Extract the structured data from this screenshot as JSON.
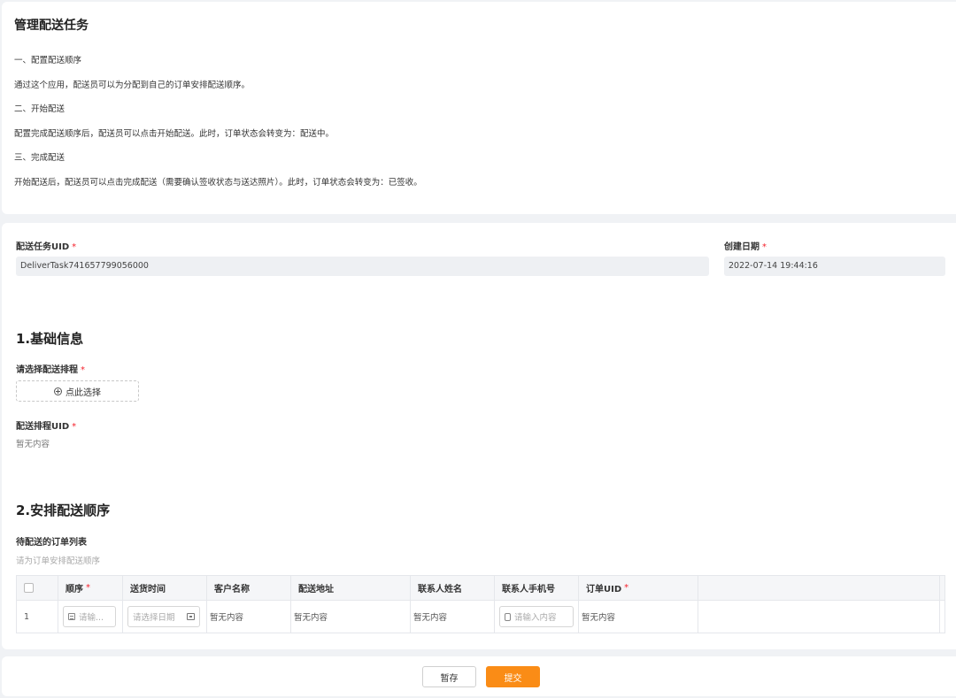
{
  "intro": {
    "title": "管理配送任务",
    "lines": [
      "一、配置配送顺序",
      "通过这个应用，配送员可以为分配到自己的订单安排配送顺序。",
      "二、开始配送",
      "配置完成配送顺序后，配送员可以点击开始配送。此时，订单状态会转变为：配送中。",
      "三、完成配送",
      "开始配送后，配送员可以点击完成配送（需要确认签收状态与送达照片）。此时，订单状态会转变为：已签收。"
    ]
  },
  "form": {
    "task_uid_label": "配送任务UID",
    "task_uid_value": "DeliverTask741657799056000",
    "created_label": "创建日期",
    "created_value": "2022-07-14 19:44:16",
    "section1": "1.基础信息",
    "schedule_label": "请选择配送排程",
    "pick_label": "点此选择",
    "schedule_uid_label": "配送排程UID",
    "schedule_uid_value": "暂无内容",
    "section2": "2.安排配送顺序",
    "orders_label": "待配送的订单列表",
    "orders_hint": "请为订单安排配送顺序"
  },
  "table": {
    "headers": [
      "顺序",
      "送货时间",
      "客户名称",
      "配送地址",
      "联系人姓名",
      "联系人手机号",
      "订单UID"
    ],
    "row": {
      "index": "1",
      "order_placeholder": "请输...",
      "date_placeholder": "请选择日期",
      "customer": "暂无内容",
      "address": "暂无内容",
      "contact": "暂无内容",
      "phone_placeholder": "请输入内容",
      "order_uid": "暂无内容"
    }
  },
  "footer": {
    "save": "暂存",
    "submit": "提交"
  },
  "colors": {
    "accent": "#fa8c16",
    "required": "#f5222d"
  }
}
